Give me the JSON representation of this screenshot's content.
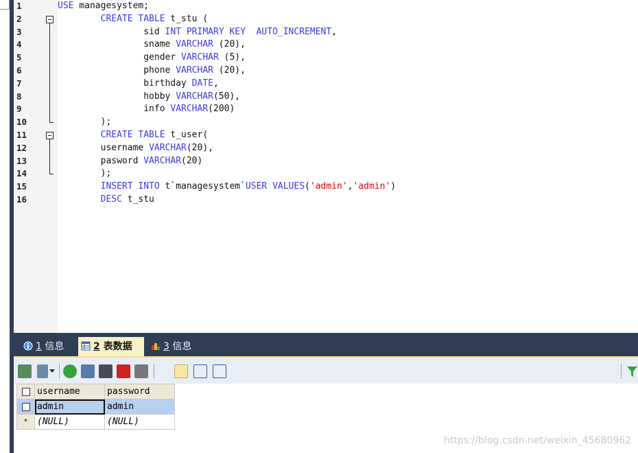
{
  "editor": {
    "line_numbers": [
      "1",
      "2",
      "3",
      "4",
      "5",
      "6",
      "7",
      "8",
      "9",
      "10",
      "11",
      "12",
      "13",
      "14",
      "15",
      "16"
    ],
    "lines": [
      [
        {
          "t": "USE ",
          "c": "kw"
        },
        {
          "t": "managesystem;",
          "c": ""
        }
      ],
      [
        {
          "t": "        CREATE TABLE ",
          "c": "kw"
        },
        {
          "t": "t_stu (",
          "c": ""
        }
      ],
      [
        {
          "t": "                sid ",
          "c": ""
        },
        {
          "t": "INT PRIMARY KEY  AUTO_INCREMENT",
          "c": "kw"
        },
        {
          "t": ",",
          "c": ""
        }
      ],
      [
        {
          "t": "                sname ",
          "c": ""
        },
        {
          "t": "VARCHAR",
          "c": "kw"
        },
        {
          "t": " (20),",
          "c": ""
        }
      ],
      [
        {
          "t": "                gender ",
          "c": ""
        },
        {
          "t": "VARCHAR",
          "c": "kw"
        },
        {
          "t": " (5),",
          "c": ""
        }
      ],
      [
        {
          "t": "                phone ",
          "c": ""
        },
        {
          "t": "VARCHAR",
          "c": "kw"
        },
        {
          "t": " (20),",
          "c": ""
        }
      ],
      [
        {
          "t": "                birthday ",
          "c": ""
        },
        {
          "t": "DATE",
          "c": "kw"
        },
        {
          "t": ",",
          "c": ""
        }
      ],
      [
        {
          "t": "                hobby ",
          "c": ""
        },
        {
          "t": "VARCHAR",
          "c": "kw"
        },
        {
          "t": "(50),",
          "c": ""
        }
      ],
      [
        {
          "t": "                info ",
          "c": ""
        },
        {
          "t": "VARCHAR",
          "c": "kw"
        },
        {
          "t": "(200)",
          "c": ""
        }
      ],
      [
        {
          "t": "        );",
          "c": ""
        }
      ],
      [
        {
          "t": "        CREATE TABLE ",
          "c": "kw"
        },
        {
          "t": "t_user(",
          "c": ""
        }
      ],
      [
        {
          "t": "        username ",
          "c": ""
        },
        {
          "t": "VARCHAR",
          "c": "kw"
        },
        {
          "t": "(20),",
          "c": ""
        }
      ],
      [
        {
          "t": "        pasword ",
          "c": ""
        },
        {
          "t": "VARCHAR",
          "c": "kw"
        },
        {
          "t": "(20)",
          "c": ""
        }
      ],
      [
        {
          "t": "        );",
          "c": ""
        }
      ],
      [
        {
          "t": "        INSERT INTO ",
          "c": "kw"
        },
        {
          "t": "t`managesystem`",
          "c": ""
        },
        {
          "t": "USER VALUES",
          "c": "kw"
        },
        {
          "t": "(",
          "c": ""
        },
        {
          "t": "'admin'",
          "c": "str"
        },
        {
          "t": ",",
          "c": ""
        },
        {
          "t": "'admin'",
          "c": "str"
        },
        {
          "t": ")",
          "c": ""
        }
      ],
      [
        {
          "t": "        DESC ",
          "c": "kw"
        },
        {
          "t": "t_stu",
          "c": ""
        }
      ]
    ]
  },
  "tabs": [
    {
      "num": "1",
      "label": " 信息",
      "icon": "info-icon"
    },
    {
      "num": "2",
      "label": " 表数据",
      "icon": "table-icon"
    },
    {
      "num": "3",
      "label": " 信息",
      "icon": "chart-icon"
    }
  ],
  "grid": {
    "headers": [
      "username",
      "password"
    ],
    "rows": [
      {
        "marker": "",
        "cells": [
          "admin",
          "admin"
        ]
      },
      {
        "marker": "*",
        "cells": [
          "(NULL)",
          "(NULL)"
        ]
      }
    ]
  },
  "watermark": "https://blog.csdn.net/weixin_45680962",
  "colors": {
    "keyword": "#3a3ae6",
    "string": "#e00000",
    "panel": "#2f3e55"
  }
}
